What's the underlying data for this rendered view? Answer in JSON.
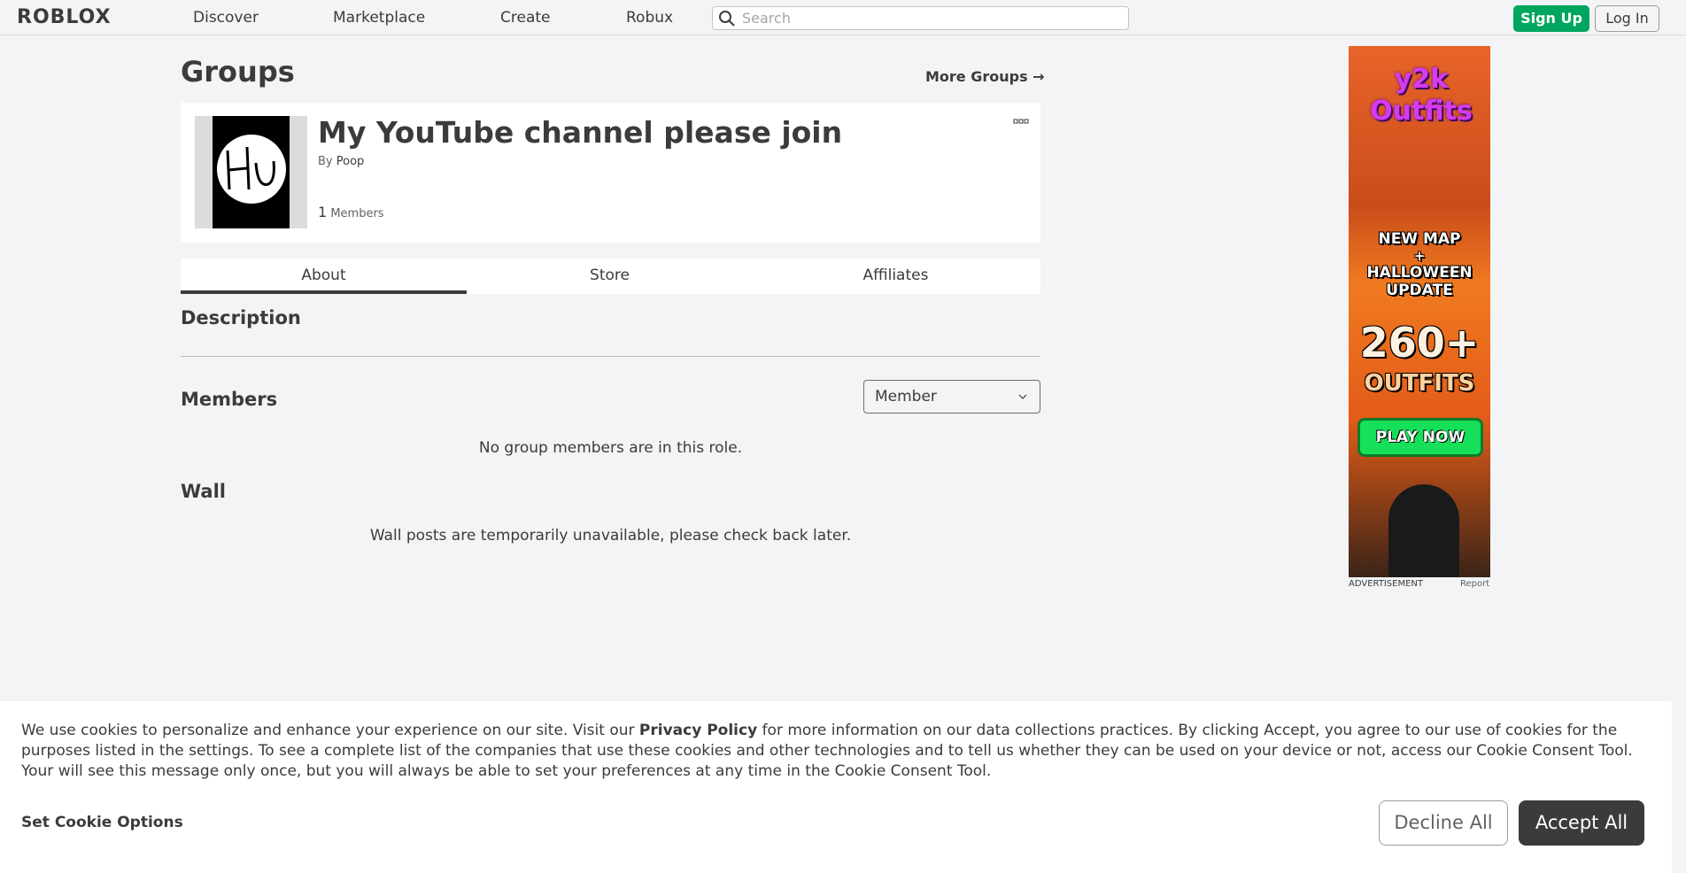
{
  "header": {
    "logo": "ROBLOX",
    "nav": [
      "Discover",
      "Marketplace",
      "Create",
      "Robux"
    ],
    "search_placeholder": "Search",
    "signup_label": "Sign Up",
    "login_label": "Log In"
  },
  "page": {
    "title": "Groups",
    "more_groups": "More Groups →"
  },
  "group": {
    "name": "My YouTube channel please join",
    "by_prefix": "By",
    "owner": "Poop",
    "member_count": "1",
    "members_label": "Members"
  },
  "tabs": [
    "About",
    "Store",
    "Affiliates"
  ],
  "about": {
    "description_title": "Description",
    "members_title": "Members",
    "role_selected": "Member",
    "members_empty": "No group members are in this role.",
    "wall_title": "Wall",
    "wall_empty": "Wall posts are temporarily unavailable, please check back later."
  },
  "ad": {
    "brand": "y2k Outfits",
    "line1": "NEW MAP",
    "line2": "+",
    "line3": "HALLOWEEN",
    "line4": "UPDATE",
    "count": "260+",
    "outfits": "OUTFITS",
    "play": "PLAY NOW",
    "label": "ADVERTISEMENT",
    "report": "Report"
  },
  "cookie": {
    "text_before": "We use cookies to personalize and enhance your experience on our site. Visit our ",
    "privacy_link": "Privacy Policy",
    "text_after": " for more information on our data collections practices. By clicking Accept, you agree to our use of cookies for the purposes listed in the settings. To see a complete list of the companies that use these cookies and other technologies and to tell us whether they can be used on your device or not, access our Cookie Consent Tool. Your will see this message only once, but you will always be able to set your preferences at any time in the Cookie Consent Tool.",
    "options_label": "Set Cookie Options",
    "decline_label": "Decline All",
    "accept_label": "Accept All"
  }
}
